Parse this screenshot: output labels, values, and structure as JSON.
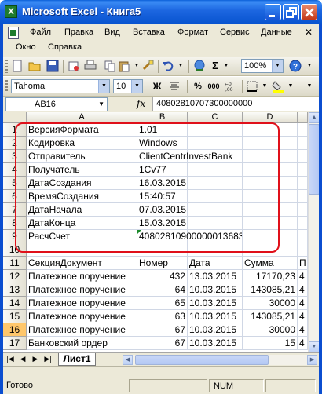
{
  "window": {
    "title": "Microsoft Excel - Книга5",
    "app_icon_letter": "X"
  },
  "menu": {
    "row1": [
      "Файл",
      "Правка",
      "Вид",
      "Вставка",
      "Формат",
      "Сервис",
      "Данные"
    ],
    "row2": [
      "Окно",
      "Справка"
    ]
  },
  "toolbar": {
    "zoom": "100%",
    "font_name": "Tahoma",
    "font_size": "10",
    "bold_label": "Ж",
    "percent_label": "%",
    "thousands_label": "000"
  },
  "formula_bar": {
    "name_box": "AB16",
    "fx_label": "fx",
    "value": "40802810707300000000"
  },
  "columns": [
    "A",
    "B",
    "C",
    "D"
  ],
  "rows": [
    {
      "num": "1",
      "a": "ВерсияФормата",
      "b": "1.01",
      "c": "",
      "d": ""
    },
    {
      "num": "2",
      "a": "Кодировка",
      "b": "Windows",
      "c": "",
      "d": ""
    },
    {
      "num": "3",
      "a": "Отправитель",
      "b": "ClientCentrInvestBank",
      "c": "",
      "d": ""
    },
    {
      "num": "4",
      "a": "Получатель",
      "b": "1Cv77",
      "c": "",
      "d": ""
    },
    {
      "num": "5",
      "a": "ДатаСоздания",
      "b": "16.03.2015",
      "c": "",
      "d": ""
    },
    {
      "num": "6",
      "a": "ВремяСоздания",
      "b": "15:40:57",
      "c": "",
      "d": ""
    },
    {
      "num": "7",
      "a": "ДатаНачала",
      "b": "07.03.2015",
      "c": "",
      "d": ""
    },
    {
      "num": "8",
      "a": "ДатаКонца",
      "b": "15.03.2015",
      "c": "",
      "d": ""
    },
    {
      "num": "9",
      "a": "РасчСчет",
      "b": "40802810900000013683",
      "c": "",
      "d": ""
    },
    {
      "num": "10",
      "a": "",
      "b": "",
      "c": "",
      "d": ""
    },
    {
      "num": "11",
      "a": "СекцияДокумент",
      "b": "Номер",
      "c": "Дата",
      "d": "Сумма",
      "e": "П"
    },
    {
      "num": "12",
      "a": "Платежное поручение",
      "b": "432",
      "c": "13.03.2015",
      "d": "17170,23",
      "e": "4"
    },
    {
      "num": "13",
      "a": "Платежное поручение",
      "b": "64",
      "c": "10.03.2015",
      "d": "143085,21",
      "e": "4"
    },
    {
      "num": "14",
      "a": "Платежное поручение",
      "b": "65",
      "c": "10.03.2015",
      "d": "30000",
      "e": "4"
    },
    {
      "num": "15",
      "a": "Платежное поручение",
      "b": "63",
      "c": "10.03.2015",
      "d": "143085,21",
      "e": "4"
    },
    {
      "num": "16",
      "a": "Платежное поручение",
      "b": "67",
      "c": "10.03.2015",
      "d": "30000",
      "e": "4"
    },
    {
      "num": "17",
      "a": "Банковский ордер",
      "b": "67",
      "c": "10.03.2015",
      "d": "15",
      "e": "4"
    }
  ],
  "selected_row": "16",
  "sheet_tab": "Лист1",
  "status": {
    "ready": "Готово",
    "num": "NUM"
  }
}
